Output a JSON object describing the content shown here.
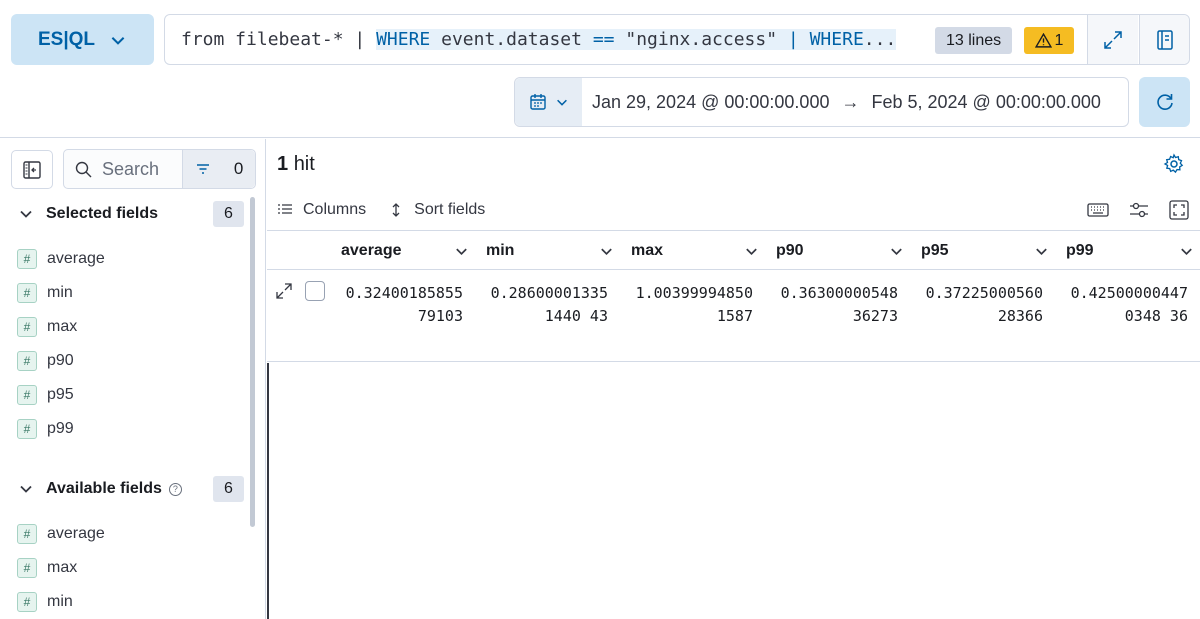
{
  "query_bar": {
    "language_label": "ES|QL",
    "query_parts": [
      "from filebeat-* | ",
      "WHERE",
      " event.dataset ",
      "==",
      " \"nginx.access\" ",
      "|",
      " ",
      "WHERE",
      "..."
    ],
    "lines_badge": "13 lines",
    "warning_count": "1"
  },
  "date_picker": {
    "start": "Jan 29, 2024 @ 00:00:00.000",
    "arrow": "→",
    "end": "Feb 5, 2024 @ 00:00:00.000"
  },
  "sidebar": {
    "search_placeholder": "Search",
    "filter_count": "0",
    "selected_title": "Selected fields",
    "selected_count": "6",
    "selected_fields": [
      "average",
      "min",
      "max",
      "p90",
      "p95",
      "p99"
    ],
    "available_title": "Available fields",
    "available_help": "?",
    "available_count": "6",
    "available_fields": [
      "average",
      "max",
      "min"
    ],
    "field_type_glyph": "#"
  },
  "results": {
    "hits_count": "1",
    "hits_label": "hit",
    "columns_label": "Columns",
    "sort_label": "Sort fields",
    "columns": [
      "average",
      "min",
      "max",
      "p90",
      "p95",
      "p99"
    ],
    "rows": [
      [
        "0.3240018585579103",
        "0.286000013351440 43",
        "1.003999948501587",
        "0.3630000054836273",
        "0.3722500056028366",
        "0.425000004470348 36"
      ]
    ]
  },
  "colors": {
    "accent": "#0061a6",
    "accent_bg": "#cce4f5",
    "warning": "#f5bc22"
  }
}
